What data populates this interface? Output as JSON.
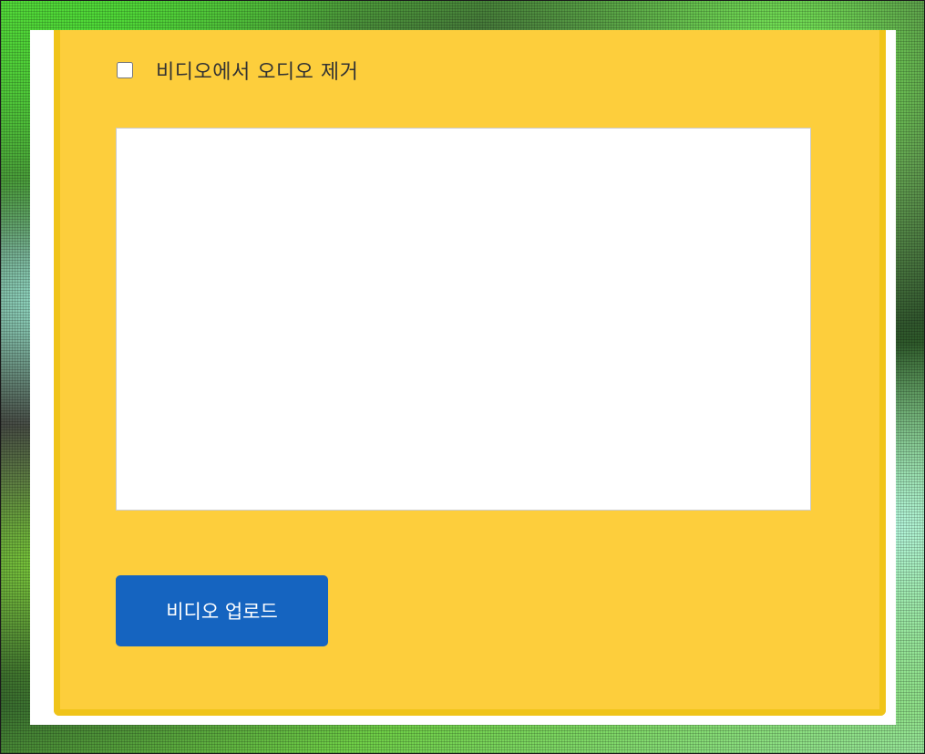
{
  "remove_audio": {
    "label": "비디오에서 오디오 제거",
    "checked": false
  },
  "upload": {
    "label": "비디오 업로드"
  },
  "colors": {
    "panel": "#fdce3c",
    "panel_border": "#f0c419",
    "button": "#1564c0"
  }
}
